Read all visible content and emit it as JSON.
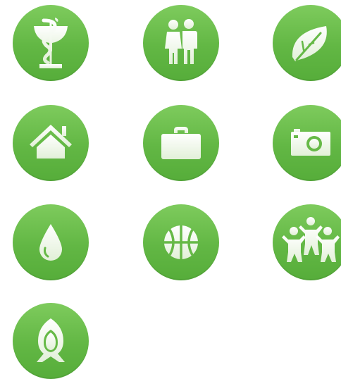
{
  "theme": {
    "circle_color": "#66b947",
    "glyph_color": "#eef7e6",
    "background": "#ffffff"
  },
  "icons": [
    {
      "name": "medicine-bowl-of-hygieia-icon"
    },
    {
      "name": "family-man-woman-icon"
    },
    {
      "name": "leaf-icon"
    },
    {
      "name": "house-icon"
    },
    {
      "name": "briefcase-icon"
    },
    {
      "name": "camera-icon"
    },
    {
      "name": "water-drop-icon"
    },
    {
      "name": "basketball-icon"
    },
    {
      "name": "children-group-icon"
    },
    {
      "name": "headscarf-face-icon"
    }
  ]
}
